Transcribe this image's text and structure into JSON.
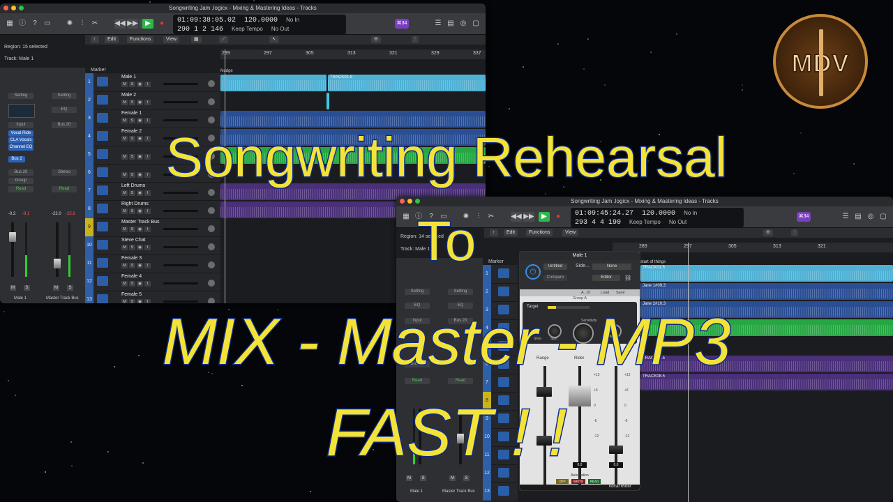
{
  "window1": {
    "title": "Songwriting Jam .logicx - Mixing & Mastering Ideas - Tracks",
    "lcd": {
      "time": "01:09:38:05.02",
      "tempo": "120.0000",
      "key_in": "No In",
      "bars": "290  1  2  146",
      "tempo_mode": "Keep Tempo",
      "key_out": "No Out"
    },
    "badge": "⌘34",
    "menu": {
      "edit": "Edit",
      "functions": "Functions",
      "view": "View"
    },
    "region_info": "Region: 15 selected",
    "track_info": "Track: Male 1",
    "marker_label": "Marker",
    "ruler": [
      "289",
      "297",
      "305",
      "313",
      "321",
      "329",
      "337"
    ],
    "inspector": {
      "setting_left": "Setting",
      "setting_right": "Setting",
      "eq": "EQ",
      "input": "Input",
      "bus_send": "Bus 20",
      "plugins": [
        "Vocal Ride",
        "CLA Vocals",
        "Channel EQ"
      ],
      "bus2": "Bus 2",
      "bus20": "Bus 20",
      "stereo": "Stereo",
      "group": "Group",
      "read": "Read",
      "val1": "-0.2",
      "val2": "-8.1",
      "val3": "-22.0",
      "val4": "-25.6",
      "strip_left": "Male 1",
      "strip_right": "Master Track Bus",
      "m": "M",
      "s": "S"
    },
    "tracks": [
      {
        "num": "1",
        "name": "Male 1"
      },
      {
        "num": "2",
        "name": "Male 2"
      },
      {
        "num": "3",
        "name": "Female 1"
      },
      {
        "num": "4",
        "name": "Female 2"
      },
      {
        "num": "5",
        "name": ""
      },
      {
        "num": "6",
        "name": ""
      },
      {
        "num": "7",
        "name": "Left Drums"
      },
      {
        "num": "8",
        "name": "Right Drums"
      },
      {
        "num": "9",
        "name": "Master Track Bus"
      },
      {
        "num": "10",
        "name": "Steve Chat"
      },
      {
        "num": "11",
        "name": "Female 3"
      },
      {
        "num": "12",
        "name": "Female 4"
      },
      {
        "num": "13",
        "name": "Female 5"
      }
    ],
    "regions": {
      "r1": "TRACK01.8",
      "nudge": "Nudge"
    }
  },
  "window2": {
    "title": "Songwriting Jam .logicx - Mixing & Mastering Ideas - Tracks",
    "lcd": {
      "time": "01:09:45:24.27",
      "tempo": "120.0000",
      "key_in": "No In",
      "bars": "293  4  4  190",
      "tempo_mode": "Keep Tempo",
      "key_out": "No Out"
    },
    "badge": "⌘34",
    "menu": {
      "edit": "Edit",
      "functions": "Functions",
      "view": "View"
    },
    "region_info": "Region: 14 selected",
    "track_info": "Track: Male 1",
    "marker_label": "Marker",
    "ruler": [
      "281",
      "289",
      "297",
      "305",
      "313",
      "321"
    ],
    "inspector": {
      "setting_left": "Setting",
      "setting_right": "Setting",
      "eq": "EQ",
      "input": "Input",
      "bus20": "Bus 20",
      "bus2": "Bus 20",
      "read": "Read",
      "strip_left": "Male 1",
      "strip_right": "Master Track Bus",
      "m": "M",
      "s": "S"
    },
    "track_nums": [
      "1",
      "2",
      "3",
      "4",
      "5",
      "6",
      "7",
      "8",
      "9",
      "10",
      "11",
      "12",
      "13"
    ],
    "regions": {
      "start": "start of things",
      "t1": "TRACK01.5",
      "jane1": "Jane 1#09.3",
      "jane2": "Jane 2#10.3",
      "t7": "TRACK07.5",
      "t8": "TRACK08.5"
    }
  },
  "plugin": {
    "title": "Male 1",
    "preset": "Untitled",
    "side": "Side...",
    "side_value": "None",
    "compare": "Compare",
    "editor": "Editor",
    "load": "Load",
    "save": "Save",
    "ab": "A→B",
    "group": "Group A",
    "target": "Target",
    "sensitivity": "Sensitivity",
    "slow": "Slow",
    "spill": "Spill",
    "range": "Range",
    "rider": "Rider",
    "scale_left": [
      "+12",
      "+6",
      "0",
      "-6",
      "-12"
    ],
    "scale_right": [
      "+12",
      "+6",
      "0",
      "-6",
      "-12"
    ],
    "readout_left": "0.0",
    "readout_right": "0.0",
    "automation": "Automation",
    "auto_off": "OFF",
    "auto_write": "WRITE",
    "auto_read": "READ",
    "brand": "Vocal Rider"
  },
  "logo": {
    "text": "MDV"
  },
  "headline": {
    "line1": "Songwriting Rehearsal",
    "line2": "To",
    "line3": "MIX - Master - MP3",
    "line4": "FAST ! !"
  },
  "colors": {
    "headline_fill": "#f3e338",
    "headline_stroke": "#0f2b8c",
    "track_blue": "#2b5ea8",
    "region_cyan": "#3ec7e6",
    "region_green": "#2ec24b",
    "region_purple": "#4b2f7a"
  }
}
